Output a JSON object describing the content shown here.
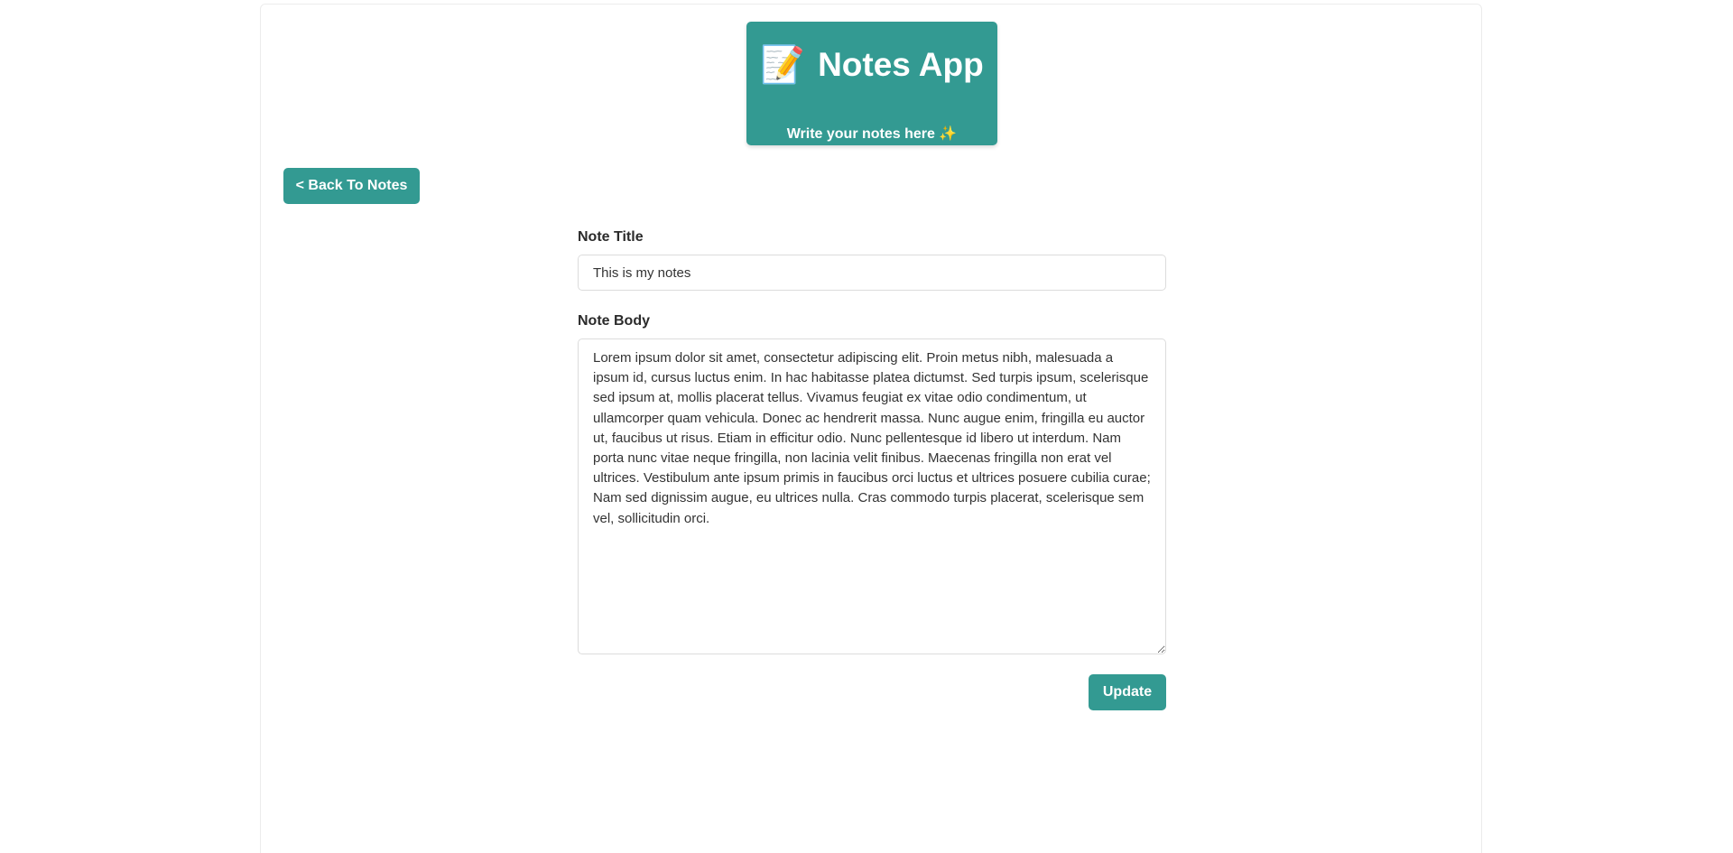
{
  "header": {
    "emoji": "📝",
    "title": "Notes App",
    "subtitle": "Write your notes here ✨"
  },
  "nav": {
    "back_label": "< Back To Notes"
  },
  "form": {
    "title_label": "Note Title",
    "title_value": "This is my notes",
    "body_label": "Note Body",
    "body_value": "Lorem ipsum dolor sit amet, consectetur adipiscing elit. Proin metus nibh, malesuada a ipsum id, cursus luctus enim. In hac habitasse platea dictumst. Sed turpis ipsum, scelerisque sed ipsum at, mollis placerat tellus. Vivamus feugiat ex vitae odio condimentum, ut ullamcorper quam vehicula. Donec ac hendrerit massa. Nunc augue enim, fringilla eu auctor ut, faucibus ut risus. Etiam in efficitur odio. Nunc pellentesque id libero ut interdum. Nam porta nunc vitae neque fringilla, non lacinia velit finibus. Maecenas fringilla non erat vel ultrices. Vestibulum ante ipsum primis in faucibus orci luctus et ultrices posuere cubilia curae; Nam sed dignissim augue, eu ultrices nulla. Cras commodo turpis placerat, scelerisque sem vel, sollicitudin orci.",
    "update_label": "Update"
  },
  "colors": {
    "accent": "#339a92",
    "text": "#2b2b2b",
    "border": "#dcdcdc"
  }
}
